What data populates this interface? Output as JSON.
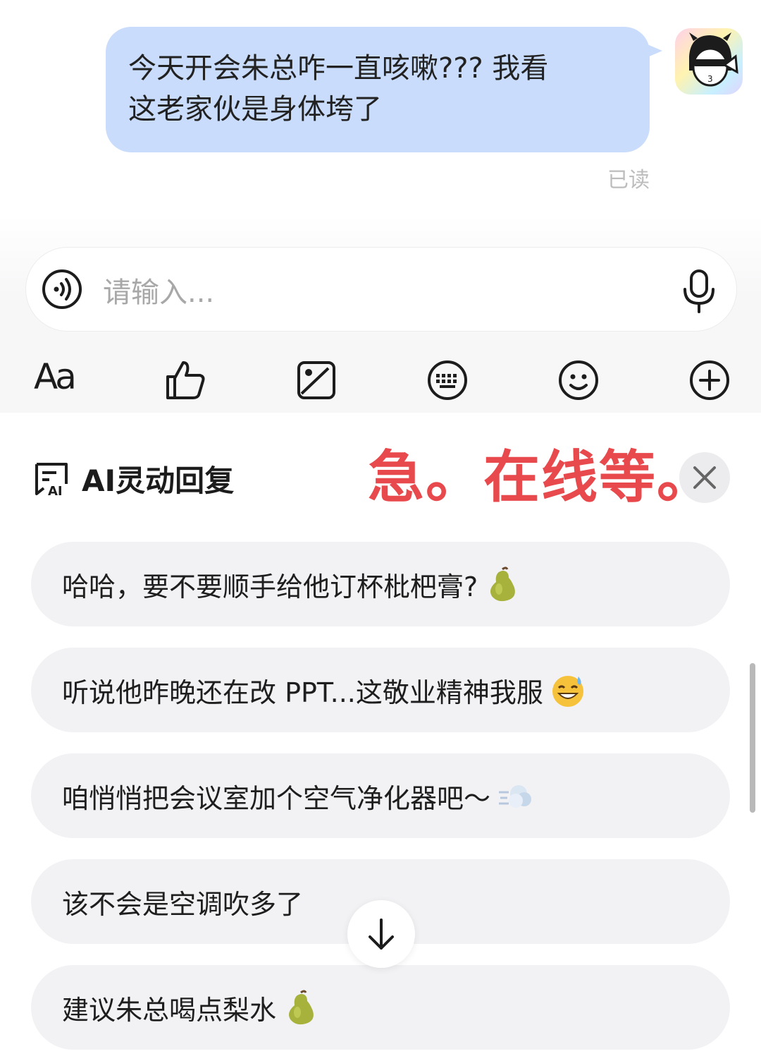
{
  "message": {
    "text_line1": "今天开会朱总咋一直咳嗽???  我看",
    "text_line2": "这老家伙是身体垮了",
    "status": "已读",
    "bubble_color": "#c9dcfb"
  },
  "input": {
    "placeholder": "请输入..."
  },
  "toolbar": {
    "items": [
      {
        "name": "font-icon",
        "label": "Aa"
      },
      {
        "name": "thumbs-up-icon"
      },
      {
        "name": "image-icon"
      },
      {
        "name": "keyboard-icon"
      },
      {
        "name": "emoji-icon"
      },
      {
        "name": "plus-icon"
      }
    ]
  },
  "ai_reply": {
    "title": "AI灵动回复",
    "overlay_text": "急。在线等。",
    "overlay_color": "#e8494d"
  },
  "suggestions": [
    {
      "text": "哈哈，要不要顺手给他订杯枇杷膏?",
      "emoji": "pear-icon"
    },
    {
      "text": "听说他昨晚还在改 PPT...这敬业精神我服",
      "emoji": "sweat-smile-icon"
    },
    {
      "text": "咱悄悄把会议室加个空气净化器吧～",
      "emoji": "dash-cloud-icon"
    },
    {
      "text": "该不会是空调吹多了",
      "emoji": ""
    },
    {
      "text": "建议朱总喝点梨水",
      "emoji": "pear-icon"
    }
  ]
}
